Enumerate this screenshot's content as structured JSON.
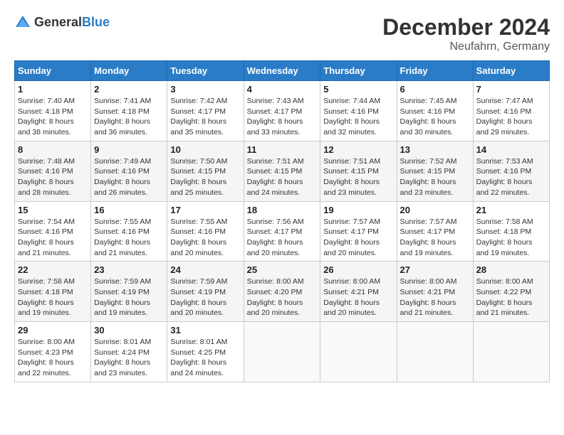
{
  "header": {
    "logo_general": "General",
    "logo_blue": "Blue",
    "title": "December 2024",
    "subtitle": "Neufahrn, Germany"
  },
  "calendar": {
    "days_of_week": [
      "Sunday",
      "Monday",
      "Tuesday",
      "Wednesday",
      "Thursday",
      "Friday",
      "Saturday"
    ],
    "weeks": [
      [
        {
          "day": "1",
          "sunrise": "7:40 AM",
          "sunset": "4:18 PM",
          "daylight": "8 hours and 38 minutes."
        },
        {
          "day": "2",
          "sunrise": "7:41 AM",
          "sunset": "4:18 PM",
          "daylight": "8 hours and 36 minutes."
        },
        {
          "day": "3",
          "sunrise": "7:42 AM",
          "sunset": "4:17 PM",
          "daylight": "8 hours and 35 minutes."
        },
        {
          "day": "4",
          "sunrise": "7:43 AM",
          "sunset": "4:17 PM",
          "daylight": "8 hours and 33 minutes."
        },
        {
          "day": "5",
          "sunrise": "7:44 AM",
          "sunset": "4:16 PM",
          "daylight": "8 hours and 32 minutes."
        },
        {
          "day": "6",
          "sunrise": "7:45 AM",
          "sunset": "4:16 PM",
          "daylight": "8 hours and 30 minutes."
        },
        {
          "day": "7",
          "sunrise": "7:47 AM",
          "sunset": "4:16 PM",
          "daylight": "8 hours and 29 minutes."
        }
      ],
      [
        {
          "day": "8",
          "sunrise": "7:48 AM",
          "sunset": "4:16 PM",
          "daylight": "8 hours and 28 minutes."
        },
        {
          "day": "9",
          "sunrise": "7:49 AM",
          "sunset": "4:16 PM",
          "daylight": "8 hours and 26 minutes."
        },
        {
          "day": "10",
          "sunrise": "7:50 AM",
          "sunset": "4:15 PM",
          "daylight": "8 hours and 25 minutes."
        },
        {
          "day": "11",
          "sunrise": "7:51 AM",
          "sunset": "4:15 PM",
          "daylight": "8 hours and 24 minutes."
        },
        {
          "day": "12",
          "sunrise": "7:51 AM",
          "sunset": "4:15 PM",
          "daylight": "8 hours and 23 minutes."
        },
        {
          "day": "13",
          "sunrise": "7:52 AM",
          "sunset": "4:15 PM",
          "daylight": "8 hours and 23 minutes."
        },
        {
          "day": "14",
          "sunrise": "7:53 AM",
          "sunset": "4:16 PM",
          "daylight": "8 hours and 22 minutes."
        }
      ],
      [
        {
          "day": "15",
          "sunrise": "7:54 AM",
          "sunset": "4:16 PM",
          "daylight": "8 hours and 21 minutes."
        },
        {
          "day": "16",
          "sunrise": "7:55 AM",
          "sunset": "4:16 PM",
          "daylight": "8 hours and 21 minutes."
        },
        {
          "day": "17",
          "sunrise": "7:55 AM",
          "sunset": "4:16 PM",
          "daylight": "8 hours and 20 minutes."
        },
        {
          "day": "18",
          "sunrise": "7:56 AM",
          "sunset": "4:17 PM",
          "daylight": "8 hours and 20 minutes."
        },
        {
          "day": "19",
          "sunrise": "7:57 AM",
          "sunset": "4:17 PM",
          "daylight": "8 hours and 20 minutes."
        },
        {
          "day": "20",
          "sunrise": "7:57 AM",
          "sunset": "4:17 PM",
          "daylight": "8 hours and 19 minutes."
        },
        {
          "day": "21",
          "sunrise": "7:58 AM",
          "sunset": "4:18 PM",
          "daylight": "8 hours and 19 minutes."
        }
      ],
      [
        {
          "day": "22",
          "sunrise": "7:58 AM",
          "sunset": "4:18 PM",
          "daylight": "8 hours and 19 minutes."
        },
        {
          "day": "23",
          "sunrise": "7:59 AM",
          "sunset": "4:19 PM",
          "daylight": "8 hours and 19 minutes."
        },
        {
          "day": "24",
          "sunrise": "7:59 AM",
          "sunset": "4:19 PM",
          "daylight": "8 hours and 20 minutes."
        },
        {
          "day": "25",
          "sunrise": "8:00 AM",
          "sunset": "4:20 PM",
          "daylight": "8 hours and 20 minutes."
        },
        {
          "day": "26",
          "sunrise": "8:00 AM",
          "sunset": "4:21 PM",
          "daylight": "8 hours and 20 minutes."
        },
        {
          "day": "27",
          "sunrise": "8:00 AM",
          "sunset": "4:21 PM",
          "daylight": "8 hours and 21 minutes."
        },
        {
          "day": "28",
          "sunrise": "8:00 AM",
          "sunset": "4:22 PM",
          "daylight": "8 hours and 21 minutes."
        }
      ],
      [
        {
          "day": "29",
          "sunrise": "8:00 AM",
          "sunset": "4:23 PM",
          "daylight": "8 hours and 22 minutes."
        },
        {
          "day": "30",
          "sunrise": "8:01 AM",
          "sunset": "4:24 PM",
          "daylight": "8 hours and 23 minutes."
        },
        {
          "day": "31",
          "sunrise": "8:01 AM",
          "sunset": "4:25 PM",
          "daylight": "8 hours and 24 minutes."
        },
        null,
        null,
        null,
        null
      ]
    ]
  }
}
